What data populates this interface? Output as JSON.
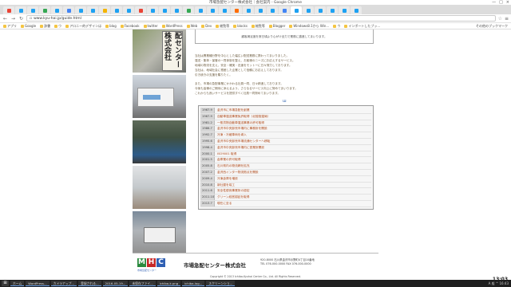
{
  "window": {
    "title": "市場急配センター株式会社｜会社案内 - Google Chrome",
    "controls": [
      "—",
      "□",
      "×"
    ]
  },
  "tabs": {
    "count": 30,
    "favicon_colors": [
      "#ea4335",
      "#1da1f2",
      "#1da1f2",
      "#34a853",
      "#1da1f2",
      "#4285f4",
      "#1da1f2",
      "#1da1f2",
      "#f4b400",
      "#1da1f2",
      "#1da1f2",
      "#ea4335",
      "#1da1f2",
      "#1da1f2",
      "#1da1f2",
      "#34a853",
      "#1da1f2",
      "#1da1f2",
      "#1da1f2",
      "#ff6d00",
      "#1da1f2",
      "#1da1f2",
      "#1da1f2",
      "#4285f4",
      "#1da1f2",
      "#1da1f2",
      "#1da1f2",
      "#1da1f2",
      "#1da1f2",
      "#1da1f2"
    ],
    "active_index": 24
  },
  "address_bar": {
    "url": "www.kyu-hai.jp/guide.html"
  },
  "bookmarks": [
    "アプリ",
    "Google",
    "辞書",
    "ウ",
    "アロニー的デザインは",
    "blog",
    "Facebook",
    "twitter",
    "WordPress",
    "Web",
    "Dev",
    "総覧等",
    "blocks",
    "総覧等",
    "Blogger",
    "Windows8.1から Win…",
    "ウ",
    "インポートしたブッ…"
  ],
  "bookmarks_other": "その他のブックマーク",
  "photo_sign_text": "配センター株式会社",
  "content": {
    "topbox_text": "顧客満足度を常日頃より心がけ全力で業務に邁進してまいります。",
    "para1": [
      "当社は異業種分野を中心とした幅広い配送業務に携わってまいりました。",
      "運送・集荷・保管の一貫体制を整え、お客様のニーズにお応えするサービス。",
      "地域の物流を支え、安全・確実・迅速をモットーに日々努力しております。",
      "当社は、地域社会に根差した企業として信頼にお応えしております。",
      "引き続きの支援を賜りたく。"
    ],
    "para2": [
      "また、市場の急配事業にかかわる社員一同、日々精進しております。",
      "今後も皆様のご期待に添えるよう、さらなるサービス向上に努めてまいります。",
      "これからも良いサービスを提供すべく社員一同努めてまいります。"
    ],
    "mark": "ш"
  },
  "history": [
    {
      "year": "1967.9",
      "text": "金沢市に市場急配を創業"
    },
    {
      "year": "1967.9",
      "text": "自動車運送事業免許取得（北陸陸運局）"
    },
    {
      "year": "1981.2",
      "text": "一般貨物自動車運送事業の許可取得"
    },
    {
      "year": "1986.7",
      "text": "金沢市中央卸売市場内に事務所を開設"
    },
    {
      "year": "1992.7",
      "text": "冷凍・冷蔵車両を導入"
    },
    {
      "year": "1995.6",
      "text": "金沢市中央卸売市場流通センターへ移転"
    },
    {
      "year": "1998.4",
      "text": "金沢市中央卸売市場内に営業所開設"
    },
    {
      "year": "2000.1",
      "text": "ISO9001 取得"
    },
    {
      "year": "2001.5",
      "text": "倉庫業の許可取得"
    },
    {
      "year": "2005.8",
      "text": "石川県内の物流網を拡充"
    },
    {
      "year": "2007.2",
      "text": "金沢西インター物流拠点を開設"
    },
    {
      "year": "2009.4",
      "text": "冷凍倉庫を増設"
    },
    {
      "year": "2010.8",
      "text": "新社屋を竣工"
    },
    {
      "year": "2011.6",
      "text": "安全性優良事業所の認定"
    },
    {
      "year": "2011.10",
      "text": "グリーン経営認証を取得"
    },
    {
      "year": "2013.7",
      "text": "現在に至る"
    }
  ],
  "footer": {
    "logo_letters": [
      "M",
      "H",
      "C"
    ],
    "logo_sub": "市場急配センター",
    "company": "市場急配センター株式会社",
    "address_lines": [
      "920-8000 石川県金沢市示野町4丁目10番地",
      "TEL 076-000-0000 FAX 076-000-0000"
    ],
    "copyright": "Copyright © 2013 Ichiba-Kyuhai Center Co., Ltd. All Rights Reserved."
  },
  "taskbar": {
    "items": [
      "ホーム",
      "WordPress...",
      "カメラアップ...",
      "登録される...",
      "2016-05-19...",
      "未保存ファイ...",
      "ichiba-k.png",
      "ichiba-log...",
      "スクリーンショ..."
    ],
    "tray": "A 般 ^ 16:43",
    "clock": "13:03"
  }
}
